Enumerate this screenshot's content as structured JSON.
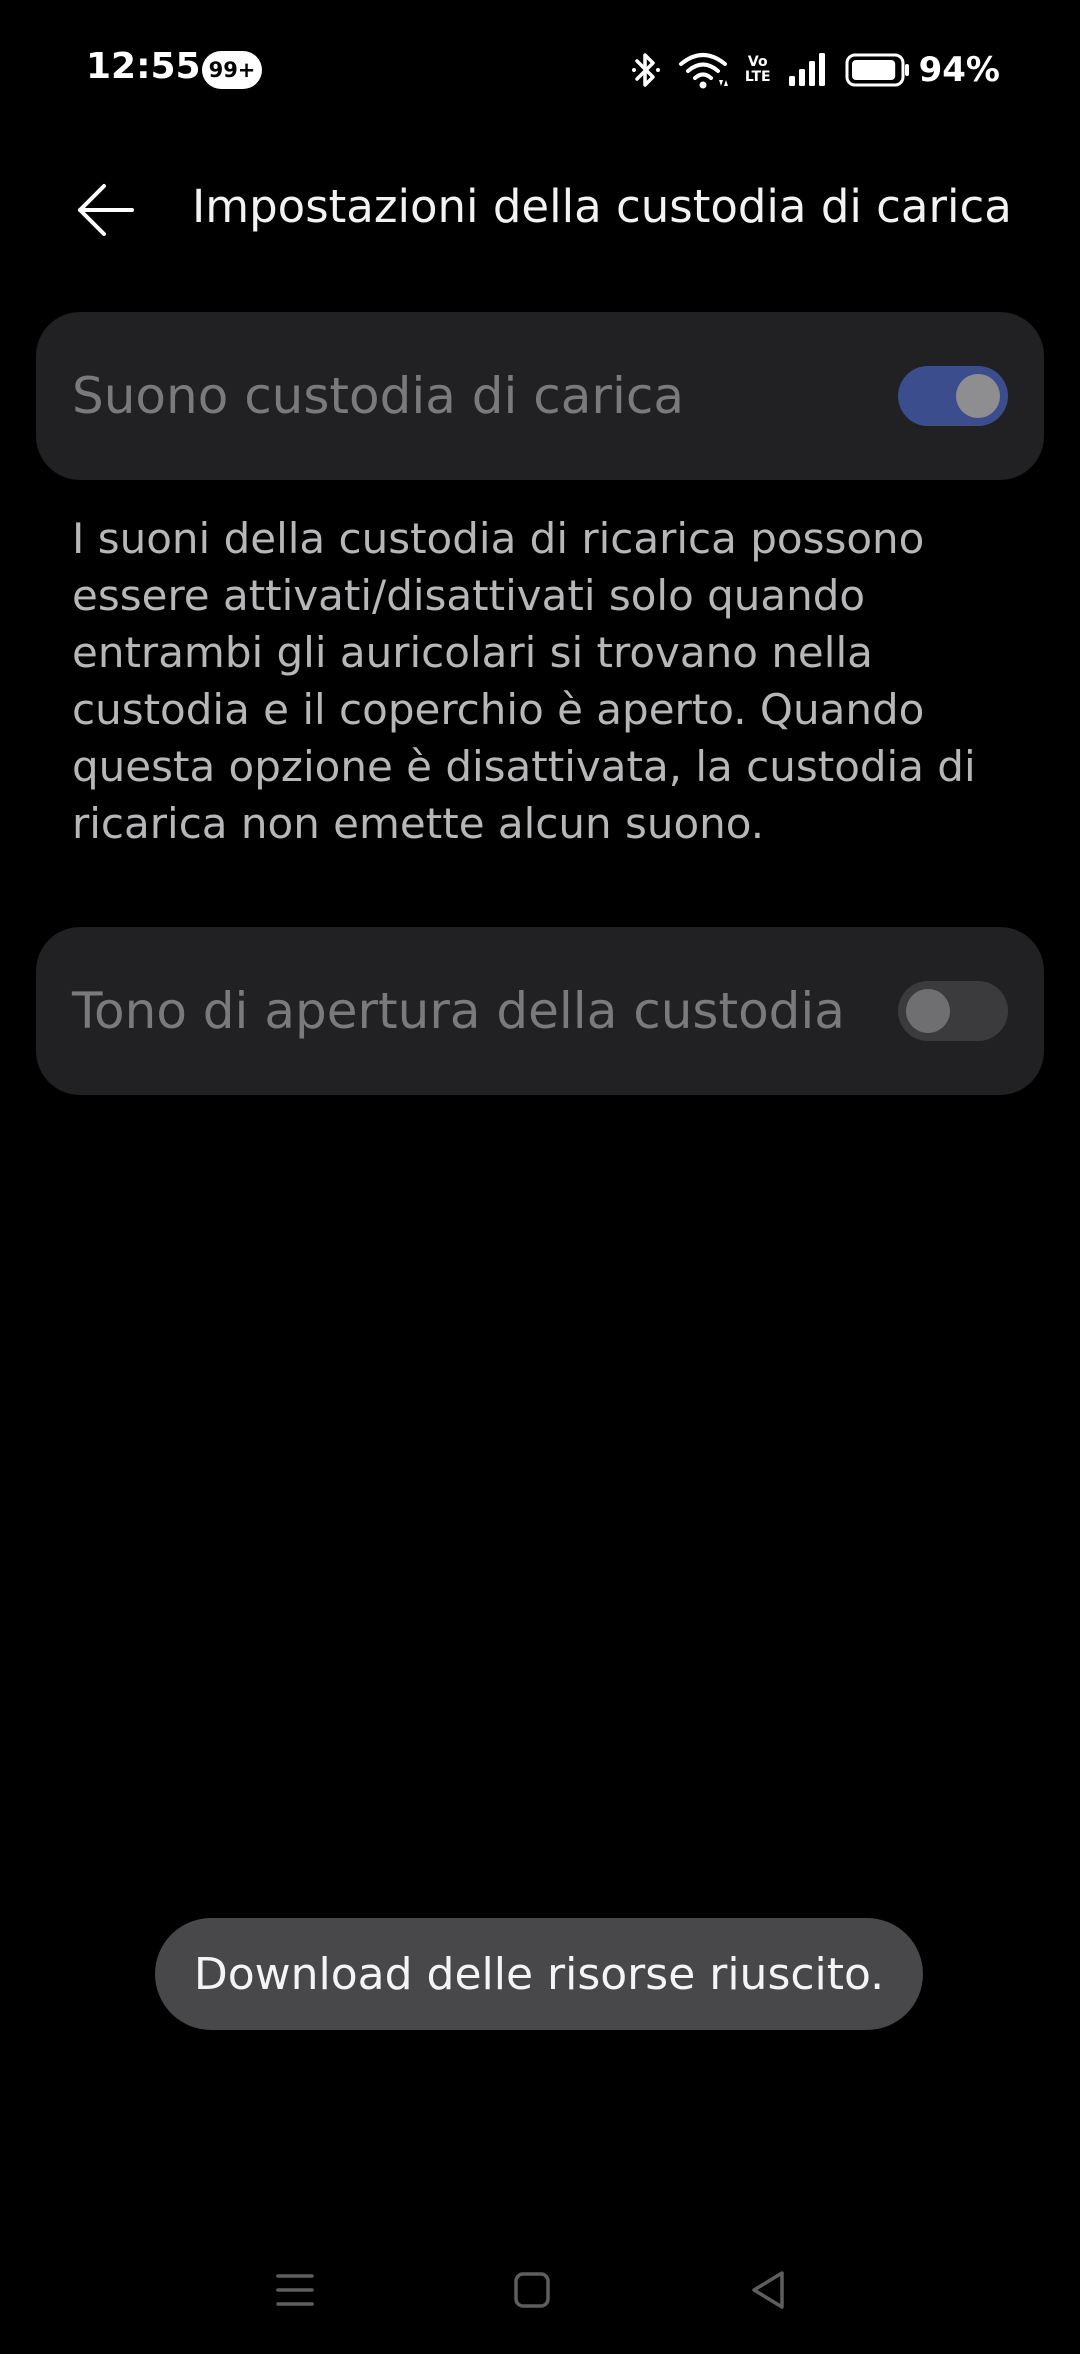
{
  "status_bar": {
    "time": "12:55",
    "notification_badge": "99+",
    "volte_top": "Vo",
    "volte_bottom": "LTE",
    "battery_percent": "94%",
    "battery_level": 0.94
  },
  "app_bar": {
    "title": "Impostazioni della custodia di carica"
  },
  "settings": {
    "charging_case_sound": {
      "label": "Suono custodia di carica",
      "enabled": true
    },
    "description": "I suoni della custodia di ricarica possono essere attivati/disattivati solo quando entrambi gli auricolari si trovano nella custodia e il coperchio è aperto. Quando questa opzione è disattivata, la custodia di ricarica non emette alcun suono.",
    "case_opening_tone": {
      "label": "Tono di apertura della custodia",
      "enabled": false
    }
  },
  "toast": {
    "message": "Download delle risorse riuscito."
  },
  "nav_bar": {
    "icons": [
      "menu-icon",
      "home-icon",
      "back-icon"
    ]
  },
  "colors": {
    "background": "#000000",
    "card": "#212123",
    "toggle_on": "#3b4d8c",
    "toggle_off": "#3b3b3d",
    "toast": "#48484a"
  }
}
